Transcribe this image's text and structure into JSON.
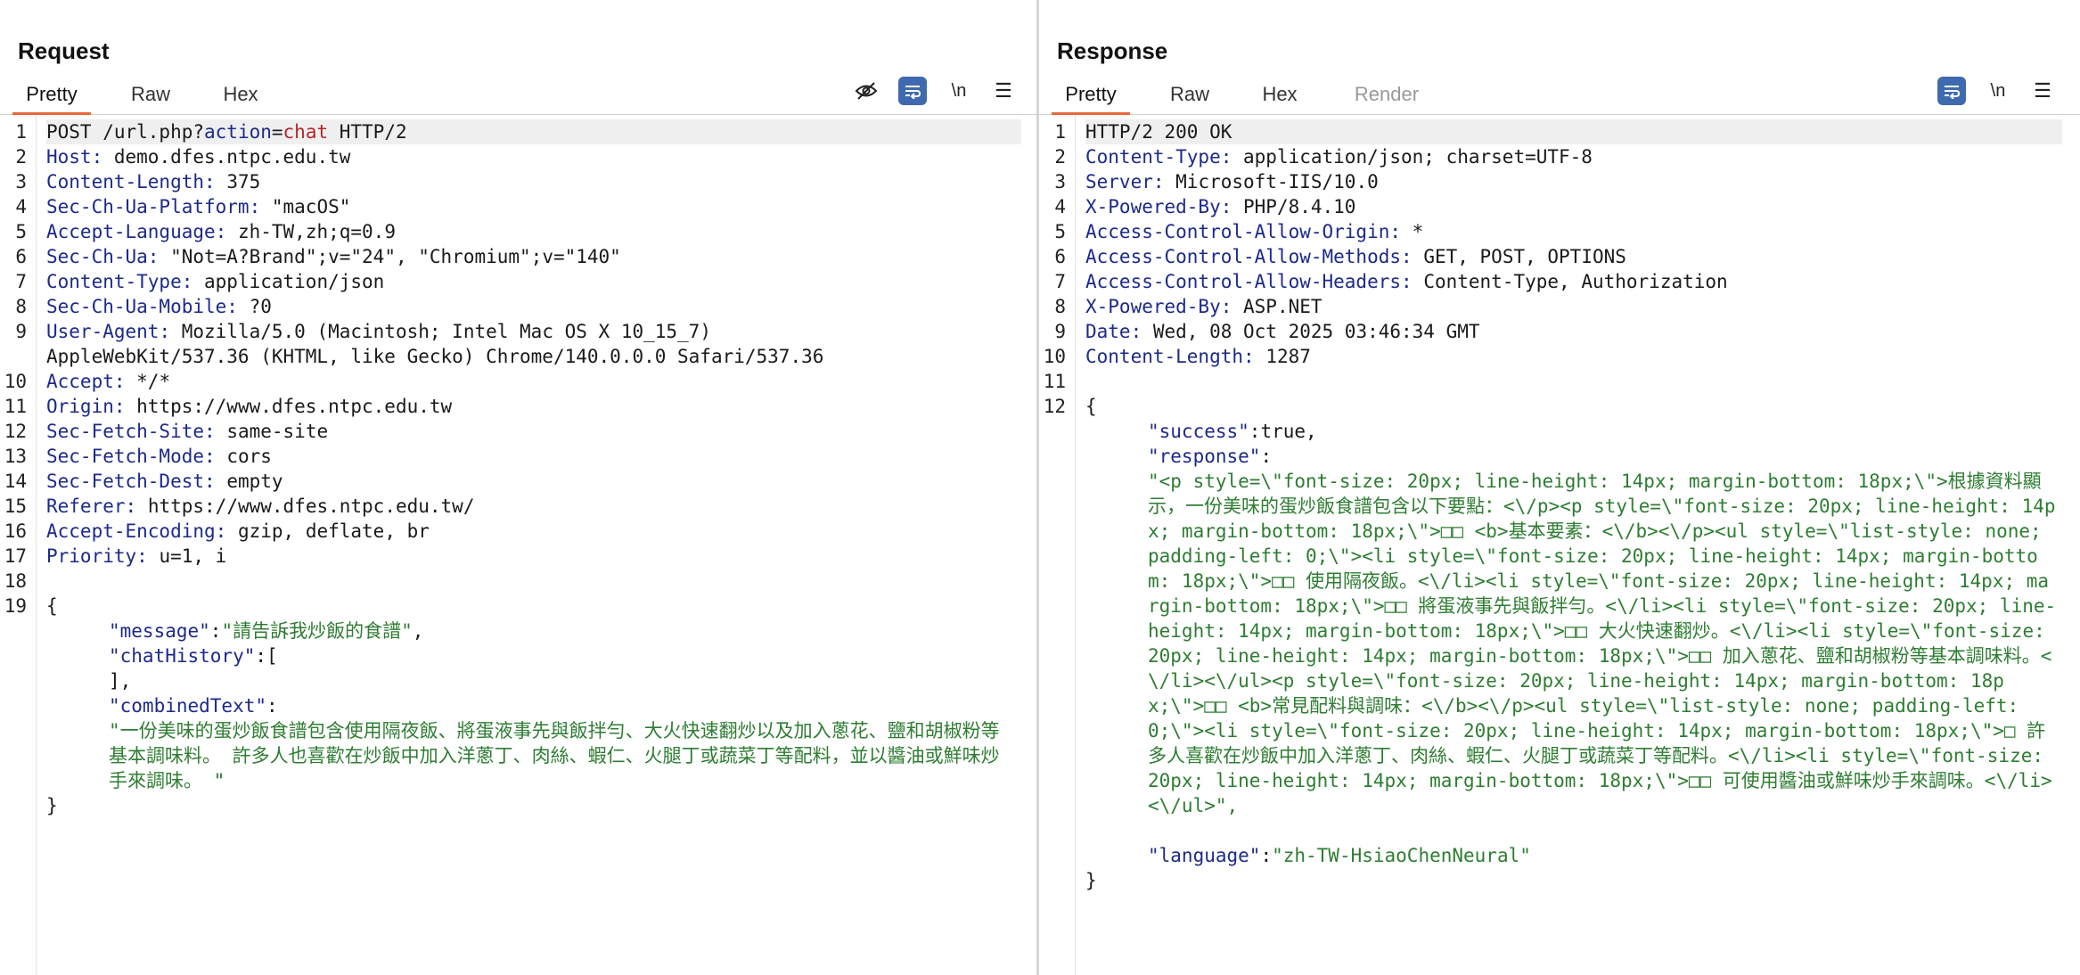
{
  "request": {
    "title": "Request",
    "tabs": [
      "Pretty",
      "Raw",
      "Hex"
    ],
    "tools": {
      "hide_icon": "eye-off-icon",
      "wrap_icon": "wrap-icon",
      "newline_label": "\\n",
      "menu_icon": "menu-icon"
    },
    "lines": [
      {
        "n": "1",
        "method": "POST /url.php?",
        "pk": "action",
        "eq": "=",
        "pv": "chat",
        "rest": " HTTP/2"
      },
      {
        "n": "2",
        "k": "Host",
        "v": " demo.dfes.ntpc.edu.tw"
      },
      {
        "n": "3",
        "k": "Content-Length",
        "v": " 375"
      },
      {
        "n": "4",
        "k": "Sec-Ch-Ua-Platform",
        "v": " \"macOS\""
      },
      {
        "n": "5",
        "k": "Accept-Language",
        "v": " zh-TW,zh;q=0.9"
      },
      {
        "n": "6",
        "k": "Sec-Ch-Ua",
        "v": " \"Not=A?Brand\";v=\"24\", \"Chromium\";v=\"140\""
      },
      {
        "n": "7",
        "k": "Content-Type",
        "v": " application/json"
      },
      {
        "n": "8",
        "k": "Sec-Ch-Ua-Mobile",
        "v": " ?0"
      },
      {
        "n": "9",
        "k": "User-Agent",
        "v": " Mozilla/5.0 (Macintosh; Intel Mac OS X 10_15_7)"
      },
      {
        "n": "",
        "v": "AppleWebKit/537.36 (KHTML, like Gecko) Chrome/140.0.0.0 Safari/537.36"
      },
      {
        "n": "10",
        "k": "Accept",
        "v": " */*"
      },
      {
        "n": "11",
        "k": "Origin",
        "v": " https://www.dfes.ntpc.edu.tw"
      },
      {
        "n": "12",
        "k": "Sec-Fetch-Site",
        "v": " same-site"
      },
      {
        "n": "13",
        "k": "Sec-Fetch-Mode",
        "v": " cors"
      },
      {
        "n": "14",
        "k": "Sec-Fetch-Dest",
        "v": " empty"
      },
      {
        "n": "15",
        "k": "Referer",
        "v": " https://www.dfes.ntpc.edu.tw/"
      },
      {
        "n": "16",
        "k": "Accept-Encoding",
        "v": " gzip, deflate, br"
      },
      {
        "n": "17",
        "k": "Priority",
        "v": " u=1, i"
      }
    ],
    "blank_line": "18",
    "body_line": "19",
    "body": {
      "open": "{",
      "message_key": "\"message\"",
      "message_val": "\"請告訴我炒飯的食譜\"",
      "history_key": "\"chatHistory\"",
      "history_open": "[",
      "history_close": "],",
      "combined_key": "\"combinedText\"",
      "combined_val": "\"一份美味的蛋炒飯食譜包含使用隔夜飯、將蛋液事先與飯拌勻、大火快速翻炒以及加入蔥花、鹽和胡椒粉等基本調味料。 許多人也喜歡在炒飯中加入洋蔥丁、肉絲、蝦仁、火腿丁或蔬菜丁等配料，並以醬油或鮮味炒手來調味。 \"",
      "close": "}"
    }
  },
  "response": {
    "title": "Response",
    "tabs": [
      "Pretty",
      "Raw",
      "Hex",
      "Render"
    ],
    "tools": {
      "wrap_icon": "wrap-icon",
      "newline_label": "\\n",
      "menu_icon": "menu-icon"
    },
    "status": "HTTP/2 200 OK",
    "lines": [
      {
        "n": "2",
        "k": "Content-Type",
        "v": " application/json; charset=UTF-8"
      },
      {
        "n": "3",
        "k": "Server",
        "v": " Microsoft-IIS/10.0"
      },
      {
        "n": "4",
        "k": "X-Powered-By",
        "v": " PHP/8.4.10"
      },
      {
        "n": "5",
        "k": "Access-Control-Allow-Origin",
        "v": " *"
      },
      {
        "n": "6",
        "k": "Access-Control-Allow-Methods",
        "v": " GET, POST, OPTIONS"
      },
      {
        "n": "7",
        "k": "Access-Control-Allow-Headers",
        "v": " Content-Type, Authorization"
      },
      {
        "n": "8",
        "k": "X-Powered-By",
        "v": " ASP.NET"
      },
      {
        "n": "9",
        "k": "Date",
        "v": " Wed, 08 Oct 2025 03:46:34 GMT"
      },
      {
        "n": "10",
        "k": "Content-Length",
        "v": " 1287"
      }
    ],
    "blank_line": "11",
    "body_line": "12",
    "body": {
      "open": "{",
      "success_key": "\"success\"",
      "success_val": "true,",
      "response_key": "\"response\"",
      "response_val": "\"<p style=\\\"font-size: 20px; line-height: 14px; margin-bottom: 18px;\\\">根據資料顯示，一份美味的蛋炒飯食譜包含以下要點：<\\/p><p style=\\\"font-size: 20px; line-height: 14px; margin-bottom: 18px;\\\">□□ <b>基本要素：<\\/b><\\/p><ul style=\\\"list-style: none; padding-left: 0;\\\"><li style=\\\"font-size: 20px; line-height: 14px; margin-bottom: 18px;\\\">□□ 使用隔夜飯。<\\/li><li style=\\\"font-size: 20px; line-height: 14px; margin-bottom: 18px;\\\">□□ 將蛋液事先與飯拌勻。<\\/li><li style=\\\"font-size: 20px; line-height: 14px; margin-bottom: 18px;\\\">□□ 大火快速翻炒。<\\/li><li style=\\\"font-size: 20px; line-height: 14px; margin-bottom: 18px;\\\">□□ 加入蔥花、鹽和胡椒粉等基本調味料。<\\/li><\\/ul><p style=\\\"font-size: 20px; line-height: 14px; margin-bottom: 18px;\\\">□□ <b>常見配料與調味：<\\/b><\\/p><ul style=\\\"list-style: none; padding-left: 0;\\\"><li style=\\\"font-size: 20px; line-height: 14px; margin-bottom: 18px;\\\">□ 許多人喜歡在炒飯中加入洋蔥丁、肉絲、蝦仁、火腿丁或蔬菜丁等配料。<\\/li><li style=\\\"font-size: 20px; line-height: 14px; margin-bottom: 18px;\\\">□□ 可使用醬油或鮮味炒手來調味。<\\/li><\\/ul>\",",
      "language_key": "\"language\"",
      "language_val": "\"zh-TW-HsiaoChenNeural\"",
      "close": "}"
    }
  },
  "layout_control": {
    "icons": [
      "split-vertical-icon",
      "split-horizontal-icon",
      "single-pane-icon"
    ]
  }
}
